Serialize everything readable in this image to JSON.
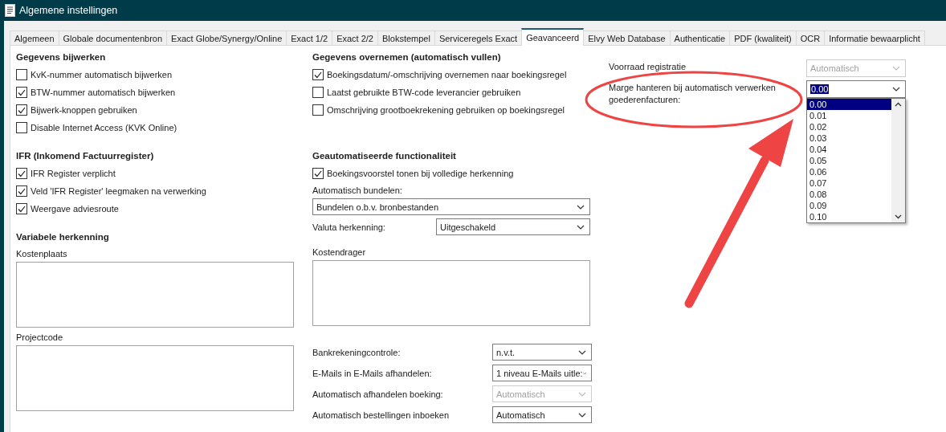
{
  "window": {
    "title": "Algemene instellingen"
  },
  "tabs": [
    {
      "label": "Algemeen",
      "selected": false
    },
    {
      "label": "Globale documentenbron",
      "selected": false
    },
    {
      "label": "Exact Globe/Synergy/Online",
      "selected": false
    },
    {
      "label": "Exact 1/2",
      "selected": false
    },
    {
      "label": "Exact 2/2",
      "selected": false
    },
    {
      "label": "Blokstempel",
      "selected": false
    },
    {
      "label": "Serviceregels Exact",
      "selected": false
    },
    {
      "label": "Geavanceerd",
      "selected": true
    },
    {
      "label": "Elvy Web Database",
      "selected": false
    },
    {
      "label": "Authenticatie",
      "selected": false
    },
    {
      "label": "PDF (kwaliteit)",
      "selected": false
    },
    {
      "label": "OCR",
      "selected": false
    },
    {
      "label": "Informatie bewaarplicht",
      "selected": false
    }
  ],
  "left_column": [
    {
      "heading": "Gegevens bijwerken",
      "items": [
        {
          "kind": "checkbox",
          "label": "KvK-nummer automatisch bijwerken",
          "checked": false
        },
        {
          "kind": "checkbox",
          "label": "BTW-nummer automatisch bijwerken",
          "checked": true
        },
        {
          "kind": "checkbox",
          "label": "Bijwerk-knoppen gebruiken",
          "checked": true
        },
        {
          "kind": "checkbox",
          "label": "Disable Internet Access (KVK Online)",
          "checked": false
        }
      ]
    },
    {
      "heading": "IFR (Inkomend Factuurregister)",
      "items": [
        {
          "kind": "checkbox",
          "label": "IFR Register verplicht",
          "checked": true
        },
        {
          "kind": "checkbox",
          "label": "Veld 'IFR Register' leegmaken na verwerking",
          "checked": true
        },
        {
          "kind": "checkbox",
          "label": "Weergave adviesroute",
          "checked": true
        }
      ]
    },
    {
      "heading": "Variabele herkenning",
      "items": [
        {
          "kind": "caption",
          "label": "Kostenplaats"
        },
        {
          "kind": "textarea"
        },
        {
          "kind": "caption",
          "label": "Projectcode"
        },
        {
          "kind": "textarea"
        }
      ]
    }
  ],
  "middle_column": [
    {
      "heading": "Gegevens overnemen (automatisch vullen)",
      "items": [
        {
          "kind": "checkbox",
          "label": "Boekingsdatum/-omschrijving overnemen naar boekingsregel",
          "checked": true
        },
        {
          "kind": "checkbox",
          "label": "Laatst gebruikte BTW-code leverancier gebruiken",
          "checked": false
        },
        {
          "kind": "checkbox",
          "label": "Omschrijving grootboekrekening gebruiken op boekingsregel",
          "checked": false
        }
      ]
    },
    {
      "heading": "Geautomatiseerde functionaliteit",
      "items": [
        {
          "kind": "checkbox",
          "label": "Boekingsvoorstel tonen bij volledige herkenning",
          "checked": true
        },
        {
          "kind": "caption",
          "label": "Automatisch bundelen:"
        },
        {
          "kind": "select",
          "value": "Bundelen o.b.v. bronbestanden",
          "disabled": false
        },
        {
          "kind": "select_row",
          "label": "Valuta herkenning:",
          "value": "Uitgeschakeld",
          "disabled": false
        },
        {
          "kind": "caption",
          "label": "Kostendrager"
        },
        {
          "kind": "textarea"
        },
        {
          "kind": "select_row_narrow",
          "label": "Bankrekeningcontrole:",
          "value": "n.v.t.",
          "disabled": false
        },
        {
          "kind": "select_row_narrow",
          "label": "E-Mails in E-Mails afhandelen:",
          "value": "1 niveau E-Mails uitle:",
          "disabled": false
        },
        {
          "kind": "select_row_narrow",
          "label": "Automatisch afhandelen boeking:",
          "value": "Automatisch",
          "disabled": true
        },
        {
          "kind": "select_row_narrow",
          "label": "Automatisch bestellingen inboeken",
          "value": "Automatisch",
          "disabled": false
        }
      ]
    }
  ],
  "right_panel": {
    "stock": {
      "label": "Voorraad registratie",
      "value": "Automatisch",
      "disabled": true
    },
    "margin": {
      "label": "Marge hanteren bij automatisch verwerken goederenfacturen:",
      "value": "0.00",
      "expanded": true,
      "options": [
        {
          "label": "0.00",
          "selected": true
        },
        {
          "label": "0.01",
          "selected": false
        },
        {
          "label": "0.02",
          "selected": false
        },
        {
          "label": "0.03",
          "selected": false
        },
        {
          "label": "0.04",
          "selected": false
        },
        {
          "label": "0.05",
          "selected": false
        },
        {
          "label": "0.06",
          "selected": false
        },
        {
          "label": "0.07",
          "selected": false
        },
        {
          "label": "0.08",
          "selected": false
        },
        {
          "label": "0.09",
          "selected": false
        },
        {
          "label": "0.10",
          "selected": false
        }
      ]
    }
  }
}
